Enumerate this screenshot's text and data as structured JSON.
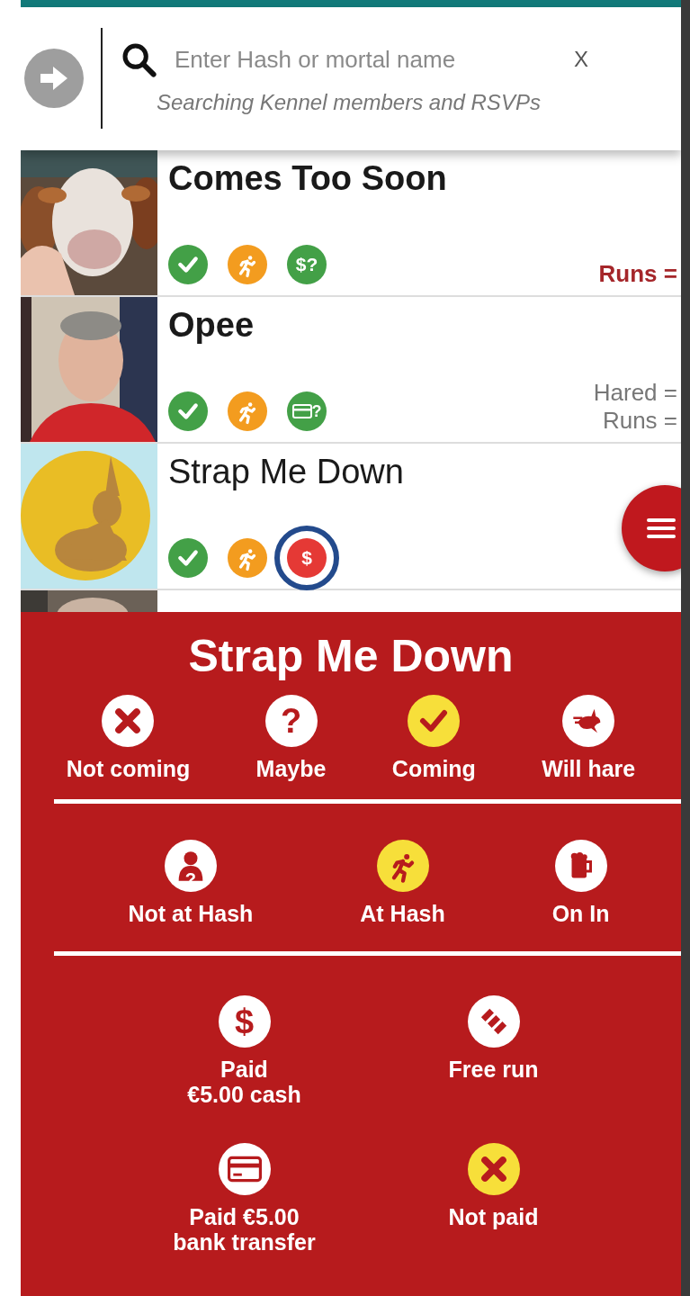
{
  "search": {
    "placeholder": "Enter Hash or mortal name",
    "clear": "X",
    "hint": "Searching Kennel members and RSVPs"
  },
  "members": [
    {
      "name": "Comes Too Soon",
      "bold": true,
      "photo": {
        "kind": "picture"
      },
      "statuses": [
        {
          "kind": "check",
          "color": "#43a047",
          "highlighted": false
        },
        {
          "kind": "runner",
          "color": "#f39c1f",
          "highlighted": false
        },
        {
          "kind": "glyph",
          "glyph": "$?",
          "color": "#43a047",
          "highlighted": false
        }
      ],
      "stats": [
        {
          "text": "Runs =",
          "color": "#a5262a"
        }
      ]
    },
    {
      "name": "Opee",
      "bold": true,
      "photo": {
        "kind": "picture"
      },
      "statuses": [
        {
          "kind": "check",
          "color": "#43a047",
          "highlighted": false
        },
        {
          "kind": "runner",
          "color": "#f39c1f",
          "highlighted": false
        },
        {
          "kind": "card",
          "glyph": "?",
          "color": "#43a047",
          "highlighted": false
        }
      ],
      "stats": [
        {
          "text": "Hared =",
          "color": "#777777"
        },
        {
          "text": "Runs =",
          "color": "#777777"
        }
      ]
    },
    {
      "name": "Strap Me Down",
      "bold": false,
      "photo": {
        "kind": "picture"
      },
      "statuses": [
        {
          "kind": "check",
          "color": "#43a047",
          "highlighted": false
        },
        {
          "kind": "runner",
          "color": "#f39c1f",
          "highlighted": false
        },
        {
          "kind": "glyph",
          "glyph": "$",
          "color": "#e53935",
          "highlighted": true
        }
      ]
    },
    {
      "photo": {
        "kind": "picture"
      }
    }
  ],
  "sheet": {
    "title": "Strap Me Down",
    "sections": [
      {
        "options": [
          {
            "label": "Not coming",
            "kind": "cross",
            "selected": false
          },
          {
            "label": "Maybe",
            "kind": "glyph",
            "glyph": "?",
            "selected": false
          },
          {
            "label": "Coming",
            "kind": "check",
            "selected": true
          },
          {
            "label": "Will hare",
            "kind": "hare",
            "selected": false
          }
        ]
      },
      {
        "options": [
          {
            "label": "Not at Hash",
            "kind": "person",
            "glyph": "?",
            "selected": false
          },
          {
            "label": "At Hash",
            "kind": "runner",
            "selected": true
          },
          {
            "label": "On In",
            "kind": "beer",
            "selected": false
          }
        ]
      },
      {
        "options": [
          {
            "label": "Paid\n€5.00 cash",
            "kind": "glyph",
            "glyph": "$",
            "selected": false
          },
          {
            "label": "Free run",
            "kind": "stamp",
            "selected": false
          },
          {
            "label": "Paid €5.00\nbank transfer",
            "kind": "card",
            "selected": false
          },
          {
            "label": "Not paid",
            "kind": "cross",
            "selected": true
          }
        ]
      }
    ]
  }
}
